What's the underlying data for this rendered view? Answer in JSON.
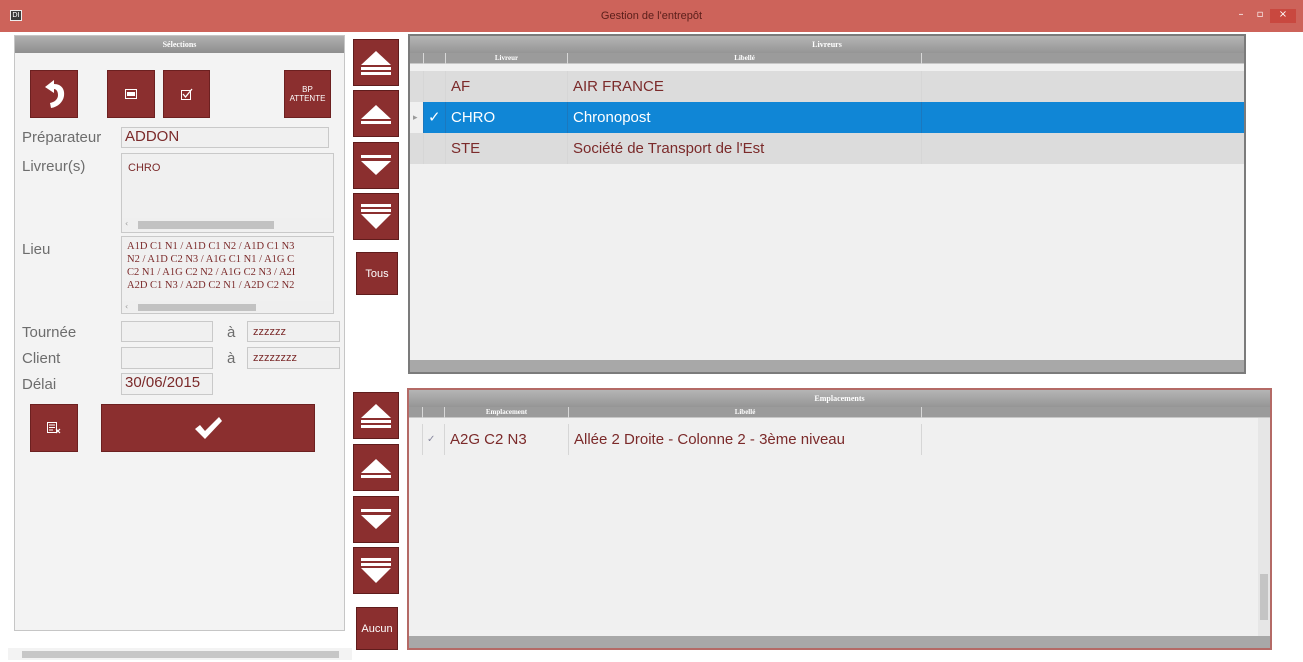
{
  "window": {
    "title": "Gestion de l'entrepôt",
    "app_icon": "DI",
    "min_glyph": "–",
    "max_glyph": "▫",
    "close_glyph": "×"
  },
  "selections": {
    "header": "Sélections",
    "bp_attente_label_line1": "BP",
    "bp_attente_label_line2": "ATTENTE",
    "preparateur_label": "Préparateur",
    "preparateur_value": "ADDON",
    "livreurs_label": "Livreur(s)",
    "livreurs_value": "CHRO",
    "lieu_label": "Lieu",
    "lieu_lines": [
      "A1D C1 N1 / A1D C1 N2 / A1D C1 N3",
      "N2 / A1D C2 N3 / A1G C1 N1 / A1G C",
      "C2 N1 / A1G C2 N2 / A1G C2 N3 / A2I",
      "A2D C1 N3 / A2D C2 N1 / A2D C2 N2"
    ],
    "tournee_label": "Tournée",
    "tournee_from": "",
    "tournee_to": "zzzzzz",
    "client_label": "Client",
    "client_from": "",
    "client_to": "zzzzzzzz",
    "a_label": "à",
    "delai_label": "Délai",
    "delai_value": "30/06/2015"
  },
  "side_buttons": {
    "tous_label": "Tous",
    "aucun_label": "Aucun"
  },
  "livreurs_grid": {
    "title": "Livreurs",
    "col_code": "Livreur",
    "col_label": "Libellé",
    "rows": [
      {
        "code": "AF",
        "label": "AIR FRANCE",
        "check": ""
      },
      {
        "code": "CHRO",
        "label": "Chronopost",
        "check": "✓"
      },
      {
        "code": "STE",
        "label": "Société de Transport de l'Est",
        "check": ""
      }
    ],
    "row_indicator": "▸",
    "selected_index": 1
  },
  "emplacements_grid": {
    "title": "Emplacements",
    "col_code": "Emplacement",
    "col_label": "Libellé",
    "rows": [
      {
        "code": "A2G C2 N3",
        "label": "Allée 2 Droite - Colonne 2 - 3ème niveau",
        "check": "✓"
      }
    ]
  },
  "colors": {
    "titlebar": "#cd635a",
    "button": "#8b2f2f",
    "text_value": "#7b2a2a",
    "selected_row": "#1086d6"
  },
  "icons": {
    "back": "back-arrow-icon",
    "deselect": "minus-box-icon",
    "select": "check-box-icon",
    "clear": "clear-filter-icon",
    "validate": "checkmark-icon",
    "first": "move-first-icon",
    "up": "move-up-icon",
    "down": "move-down-icon",
    "last": "move-last-icon"
  }
}
